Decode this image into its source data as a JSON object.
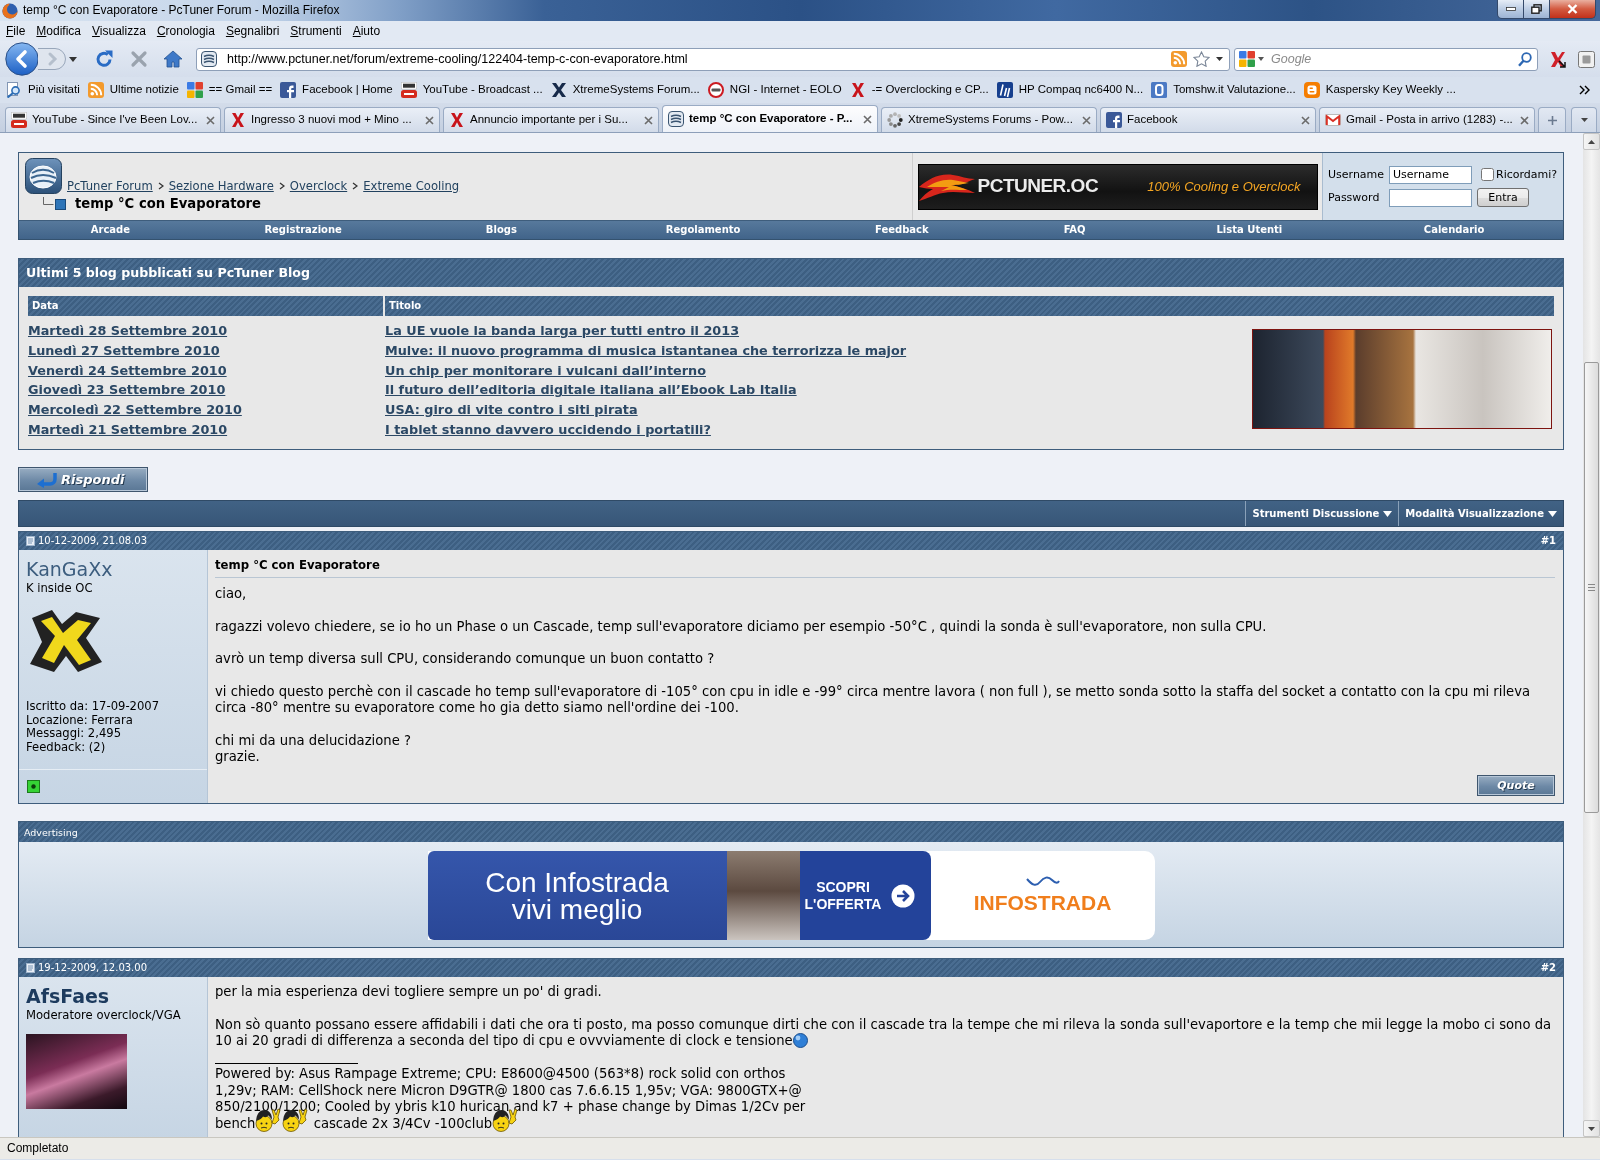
{
  "window": {
    "title": "temp °C con Evaporatore - PcTuner Forum - Mozilla Firefox"
  },
  "menu_bar": [
    "File",
    "Modifica",
    "Visualizza",
    "Cronologia",
    "Segnalibri",
    "Strumenti",
    "Aiuto"
  ],
  "navigation_toolbar": {
    "address": "http://www.pctuner.net/forum/extreme-cooling/122404-temp-c-con-evaporatore.html",
    "search_placeholder": "Google"
  },
  "bookmarks": [
    {
      "kind": "search",
      "label": "Più visitati"
    },
    {
      "kind": "rss",
      "label": "Ultime notizie"
    },
    {
      "kind": "google",
      "label": "== Gmail =="
    },
    {
      "kind": "facebook",
      "label": "Facebook | Home"
    },
    {
      "kind": "video",
      "label": "YouTube - Broadcast ..."
    },
    {
      "kind": "xmark",
      "label": "XtremeSystems Forum..."
    },
    {
      "kind": "ring",
      "label": "NGI - Internet - EOLO"
    },
    {
      "kind": "redx",
      "label": "-= Overclocking e CP..."
    },
    {
      "kind": "hp",
      "label": "HP Compaq nc6400 N..."
    },
    {
      "kind": "bsquare",
      "label": "Tomshw.it Valutazione..."
    },
    {
      "kind": "blogger",
      "label": "Kaspersky Key Weekly ..."
    }
  ],
  "tabs": [
    {
      "kind": "video",
      "label": "YouTube - Since I've Been Lov...",
      "selected": false
    },
    {
      "kind": "redx",
      "label": "Ingresso 3 nuovi mod + Mino ...",
      "selected": false
    },
    {
      "kind": "redx",
      "label": "Annuncio importante per i Su...",
      "selected": false
    },
    {
      "kind": "site",
      "label": "temp °C con Evaporatore - P...",
      "selected": true
    },
    {
      "kind": "loading",
      "label": "XtremeSystems Forums - Pow...",
      "selected": false
    },
    {
      "kind": "facebook",
      "label": "Facebook",
      "selected": false
    },
    {
      "kind": "mail",
      "label": "Gmail - Posta in arrivo (1283) -...",
      "selected": false
    }
  ],
  "forum": {
    "breadcrumb": [
      "PcTuner Forum",
      "Sezione Hardware",
      "Overclock",
      "Extreme Cooling"
    ],
    "thread_title": "temp °C con Evaporatore",
    "banner": {
      "title": "PCTUNER.OC",
      "tagline": "100% Cooling e Overclock"
    },
    "login": {
      "username_label": "Username",
      "username_value": "Username",
      "remember_label": "Ricordami?",
      "remember_checked": false,
      "password_label": "Password",
      "submit": "Entra"
    },
    "nav": [
      "Arcade",
      "Registrazione",
      "Blogs",
      "Regolamento",
      "Feedback",
      "FAQ",
      "Lista Utenti",
      "Calendario"
    ],
    "blog_panel": {
      "title": "Ultimi 5 blog pubblicati su PcTuner Blog",
      "columns": [
        "Data",
        "Titolo"
      ],
      "rows": [
        {
          "date": "Martedì 28 Settembre 2010",
          "title": "La UE vuole la banda larga per tutti entro il 2013"
        },
        {
          "date": "Lunedì 27 Settembre 2010",
          "title": "Mulve: il nuovo programma di musica istantanea che terrorizza le major"
        },
        {
          "date": "Venerdì 24 Settembre 2010",
          "title": "Un chip per monitorare i vulcani dall’interno"
        },
        {
          "date": "Giovedì 23 Settembre 2010",
          "title": "Il futuro dell’editoria digitale italiana all’Ebook Lab Italia"
        },
        {
          "date": "Mercoledì 22 Settembre 2010",
          "title": "USA: giro di vite contro i siti pirata"
        },
        {
          "date": "Martedì 21 Settembre 2010",
          "title": "I tablet stanno davvero uccidendo i portatili?"
        }
      ]
    },
    "reply_button": "Rispondi",
    "thread_tools": [
      "Strumenti Discussione",
      "Modalità Visualizzazione"
    ],
    "thread_items": [
      {
        "kind": "post",
        "date": "10-12-2009, 21.08.03",
        "number": "#1",
        "author": {
          "kind": "member",
          "name": "KanGaXx",
          "title": "K inside OC",
          "avatar": {
            "kind": "logo"
          },
          "details": [
            "Iscritto da: 17-09-2007",
            "Locazione: Ferrara",
            "Messaggi: 2,495",
            "Feedback: (2)"
          ],
          "online": true
        },
        "title": "temp °C con Evaporatore",
        "paragraphs": [
          [
            {
              "kind": "text",
              "text": "ciao,"
            }
          ],
          [
            {
              "kind": "text",
              "text": "ragazzi volevo chiedere, se io ho un Phase o un Cascade, temp sull'evaporatore diciamo per esempio -50°C , quindi la sonda è sull'evaporatore, non sulla CPU."
            }
          ],
          [
            {
              "kind": "text",
              "text": "avrò un temp diversa sull CPU, considerando comunque un buon contatto ?"
            }
          ],
          [
            {
              "kind": "text",
              "text": "vi chiedo questo perchè con il cascade ho temp sull'evaporatore di -105° con cpu in idle e -99° circa mentre lavora ( non full ), se metto sonda sotto la staffa del socket a contatto con la cpu mi rileva circa -80° mentre su evaporatore come ho gia detto siamo nell'ordine dei -100."
            }
          ],
          [
            {
              "kind": "text",
              "text": "chi mi da una delucidazione ?\ngrazie."
            }
          ]
        ],
        "quote_button": "Quote"
      },
      {
        "kind": "advertising",
        "title": "Advertising",
        "headline": "Con Infostrada\nvivi meglio",
        "cta": "SCOPRI\nL'OFFERTA",
        "brand": "INFOSTRADA"
      },
      {
        "kind": "post",
        "date": "19-12-2009, 12.03.00",
        "number": "#2",
        "author": {
          "kind": "moderator",
          "name": "AfsFaes",
          "title": "Moderatore overclock/VGA",
          "avatar": {
            "kind": "photo"
          }
        },
        "paragraphs": [
          [
            {
              "kind": "text",
              "text": "per la mia esperienza devi togliere sempre un po' di gradi."
            }
          ],
          [
            {
              "kind": "text",
              "text": "Non sò quanto possano essere affidabili i dati che ora ti posto, ma posso comunque dirti che con il cascade tra la tempe che mi rileva la sonda sull'evaportore e la temp che mii legge la mobo ci sono da 10 ai 20 gradi di differenza a seconda del tipo di cpu e ovvviamente di clock e tensione"
            },
            {
              "kind": "emoticon"
            }
          ]
        ],
        "signature": [
          {
            "kind": "text",
            "text": "Powered by: Asus Rampage Extreme; CPU: E8600@4500 (563*8) rock solid con orthos\n1,29v; RAM: CellShock nere Micron D9GTR@ 1800 cas 7.6.6.15 1,95v; VGA: 9800GTX+@\n850/2100/1200; Cooled by ybris k10 hurican and k7 + phase change by Dimas 1/2Cv per\nbench"
          },
          {
            "kind": "rocker"
          },
          {
            "kind": "rocker"
          },
          {
            "kind": "text",
            "text": " cascade 2x 3/4Cv -100club"
          },
          {
            "kind": "rocker"
          }
        ]
      }
    ]
  },
  "status_bar": {
    "text": "Completato"
  }
}
